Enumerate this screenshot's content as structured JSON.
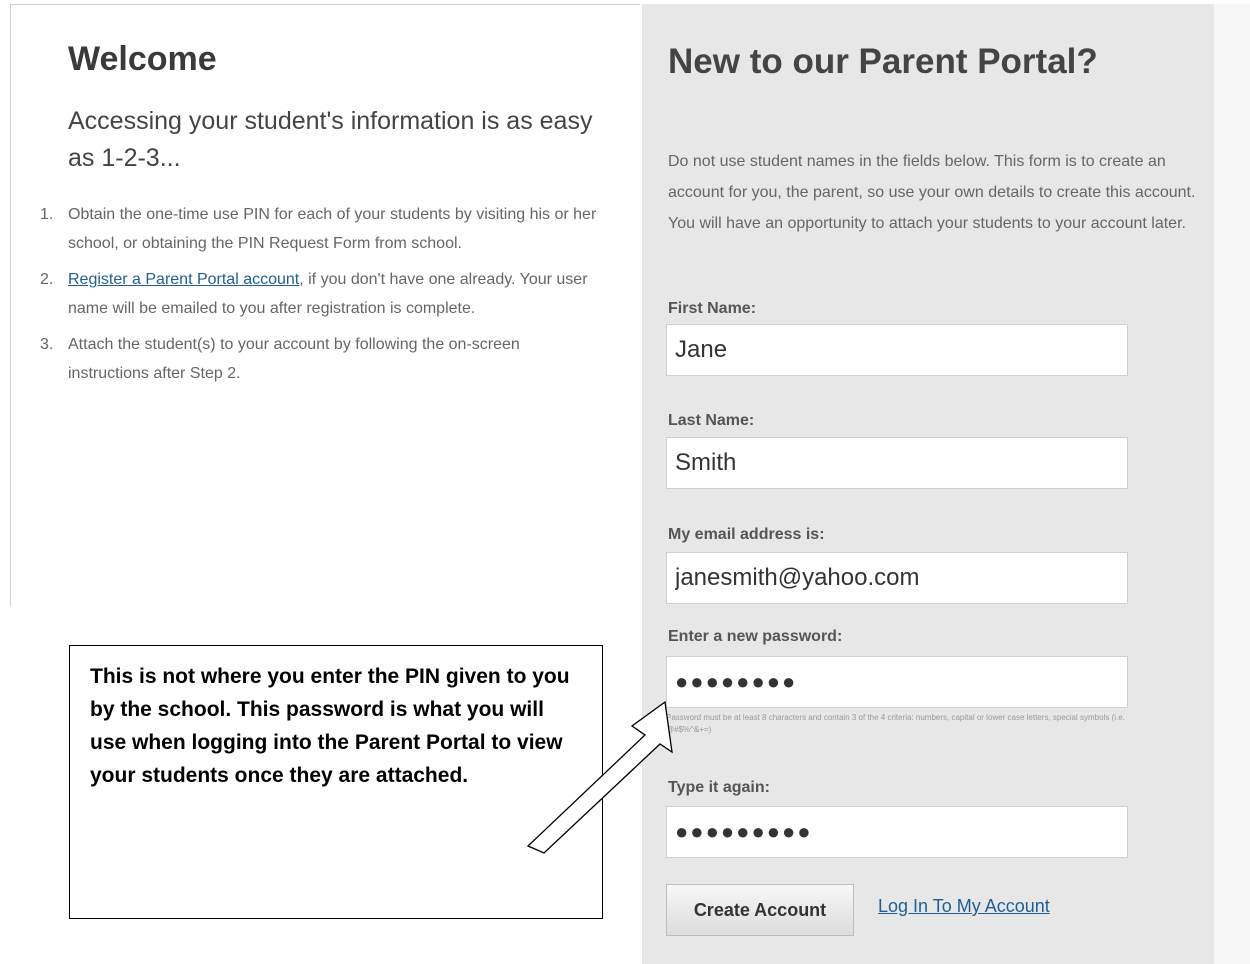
{
  "welcome": {
    "title": "Welcome",
    "subtitle": "Accessing your student's information is as easy as 1-2-3...",
    "steps": [
      {
        "number": "1.",
        "text": "Obtain the one-time use PIN for each of your students by visiting his or her school, or obtaining the PIN Request Form from school."
      },
      {
        "number": "2.",
        "link": "Register a Parent Portal account",
        "text": ", if you don't have one already. Your user name will be emailed to you after registration is complete."
      },
      {
        "number": "3.",
        "text": "Attach the student(s) to your account by following the on-screen instructions after Step 2."
      }
    ]
  },
  "form": {
    "title": "New to our Parent Portal?",
    "description": "Do not use student names in the fields below. This form is to create an account for you, the parent, so use your own details to create this account. You will have an opportunity to attach your students to your account later.",
    "first_name_label": "First Name:",
    "first_name_value": "Jane",
    "last_name_label": "Last Name:",
    "last_name_value": "Smith",
    "email_label": "My email address is:",
    "email_value": "janesmith@yahoo.com",
    "password_label": "Enter a new password:",
    "password_value": "●●●●●●●●",
    "password_hint": "Password must be at least 8 characters and contain 3 of the 4 criteria: numbers, capital or lower case letters, special symbols (i.e. @#$%^&+=)",
    "confirm_label": "Type it again:",
    "confirm_value": "●●●●●●●●●",
    "create_button": "Create Account",
    "login_link": "Log In To My Account"
  },
  "callout": {
    "text": "This is not where you enter the PIN given to you by the school.  This password is what you will use when logging into the Parent Portal to view your students once they are attached."
  }
}
